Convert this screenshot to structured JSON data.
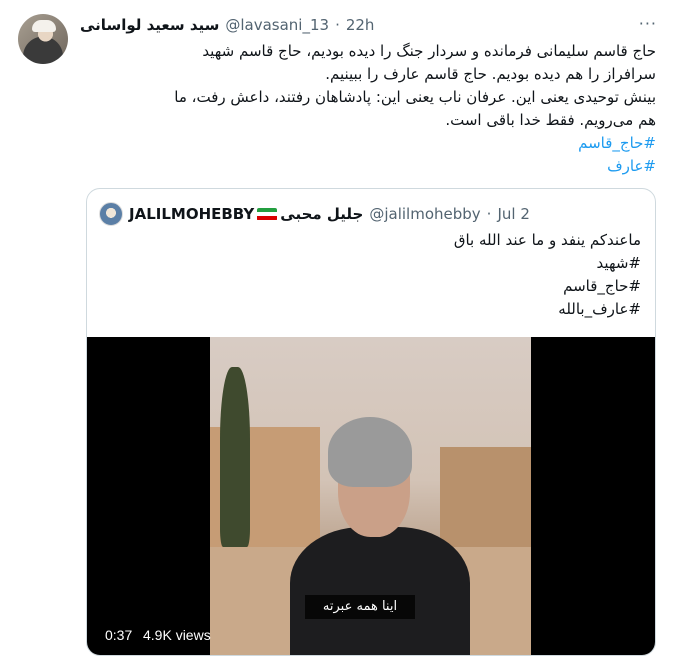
{
  "tweet": {
    "display_name": "سید سعید لواسانی",
    "handle": "@lavasani_13",
    "separator": "·",
    "time": "22h",
    "more_icon": "more-dots-icon",
    "lines": [
      "حاج قاسم سلیمانی فرمانده و سردار جنگ را دیده بودیم، حاج قاسم شهید",
      "سرافراز را هم دیده بودیم. حاج قاسم عارف را ببینیم.",
      "بینش توحیدی یعنی این. عرفان ناب یعنی این: پادشاهان رفتند، داعش رفت، ما",
      "هم می‌رویم. فقط خدا باقی است."
    ],
    "hashtags": [
      "#حاج_قاسم",
      "#عارف"
    ]
  },
  "quote": {
    "name": "JALILMOHEBBY",
    "name_suffix": "جلیل محبی",
    "handle": "@jalilmohebby",
    "separator": "·",
    "date": "Jul 2",
    "text": "ماعندکم ینفد و ما عند الله باق",
    "hashtags": [
      "#شهید",
      "#حاج_قاسم",
      "#عارف_بالله"
    ],
    "video": {
      "subtitle": "اینا همه عبرته",
      "duration": "0:37",
      "views": "4.9K views"
    }
  },
  "colors": {
    "link": "#1d9bf0",
    "secondary_text": "#536471",
    "border": "#cfd9de"
  }
}
